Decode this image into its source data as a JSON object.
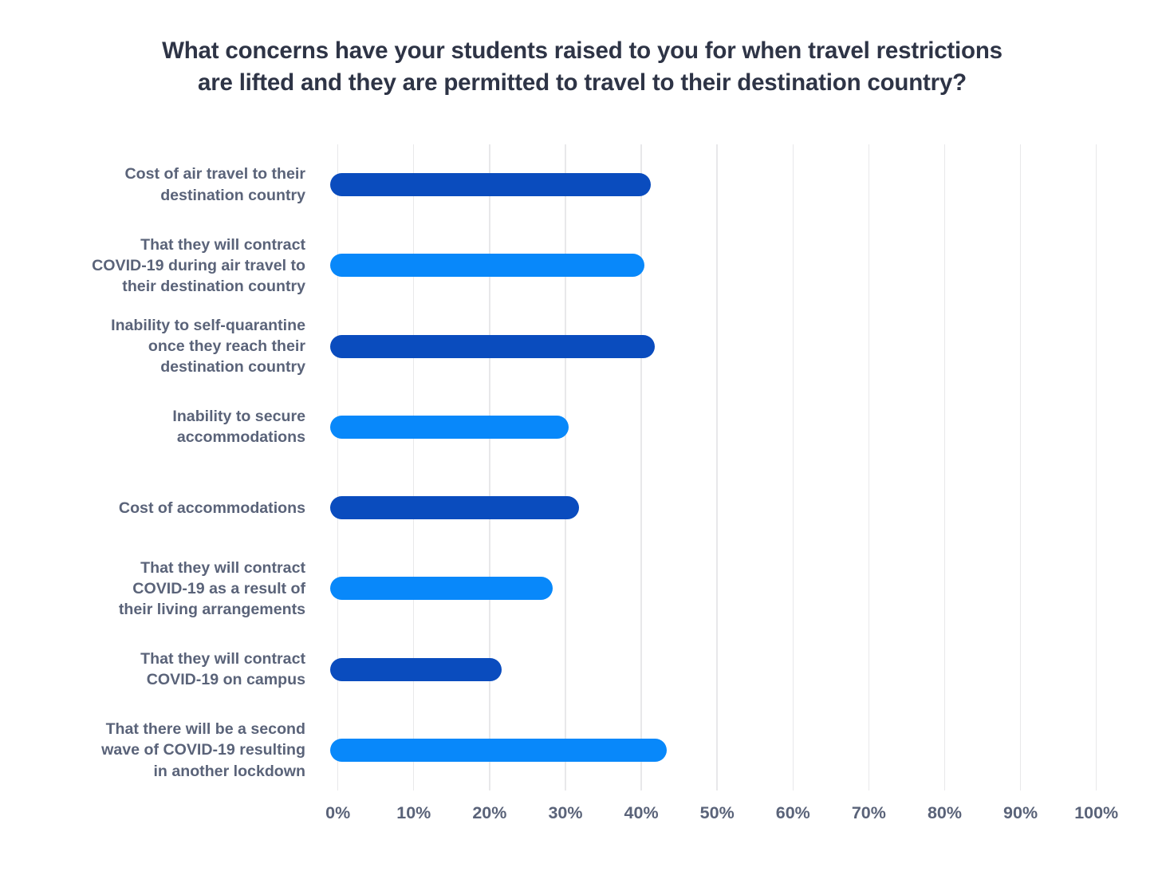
{
  "chart_data": {
    "type": "bar",
    "orientation": "horizontal",
    "title": "What concerns have your students raised to you for when travel restrictions\nare lifted and they are permitted to travel to their destination country?",
    "xlabel": "",
    "ylabel": "",
    "xlim": [
      0,
      100
    ],
    "xtick_labels": [
      "0%",
      "10%",
      "20%",
      "30%",
      "40%",
      "50%",
      "60%",
      "70%",
      "80%",
      "90%",
      "100%"
    ],
    "xtick_values": [
      0,
      10,
      20,
      30,
      40,
      50,
      60,
      70,
      80,
      90,
      100
    ],
    "grid": "vertical",
    "legend": "none",
    "value_suffix": "%",
    "categories": [
      "Cost of air travel to their\ndestination country",
      "That they will contract\nCOVID-19 during air travel to\ntheir destination country",
      "Inability to self-quarantine\nonce they reach their\ndestination country",
      "Inability to secure\naccommodations",
      "Cost of accommodations",
      "That they will contract\nCOVID-19 as a result of\ntheir living arrangements",
      "That they will contract\nCOVID-19 on campus",
      "That there will be a second\nwave of COVID-19 resulting\nin another lockdown"
    ],
    "values": [
      41.3,
      40.4,
      41.8,
      30.4,
      31.8,
      28.3,
      21.6,
      43.4
    ],
    "bar_colors": [
      "#0a4cbe",
      "#0888fa",
      "#0a4cbe",
      "#0888fa",
      "#0a4cbe",
      "#0888fa",
      "#0a4cbe",
      "#0888fa"
    ]
  },
  "colors": {
    "background": "#ffffff",
    "title_text": "#2e3446",
    "axis_text": "#5a6379",
    "gridline": "#e8e8ea",
    "bar_dark_blue": "#0a4cbe",
    "bar_light_blue": "#0888fa"
  }
}
